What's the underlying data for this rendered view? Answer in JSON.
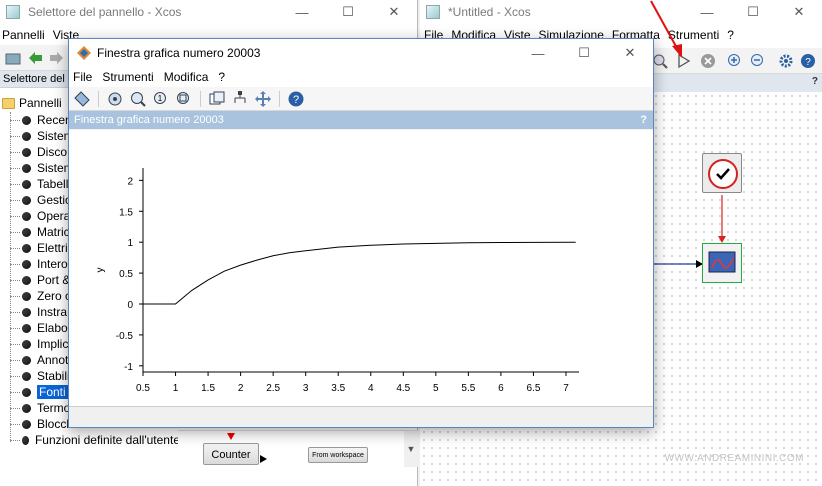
{
  "left_window": {
    "title": "Selettore del pannello - Xcos",
    "menu": [
      "Pannelli",
      "Viste"
    ],
    "panel_header": "Selettore del p",
    "tree_root": "Pannelli",
    "tree_items": [
      "Recen",
      "Sistem",
      "Disco",
      "Sistem",
      "Tabell",
      "Gestio",
      "Opera",
      "Matric",
      "Elettri",
      "Intero",
      "Port &",
      "Zero c",
      "Instra",
      "Elabor",
      "Implici",
      "Annot",
      "Stabili",
      "Fonti",
      "Termo",
      "Blocch",
      "Funzioni definite dall'utente"
    ],
    "selected_item": "Fonti",
    "blocks": {
      "counter": "Counter",
      "from_workspace": "From workspace"
    }
  },
  "right_window": {
    "title": "*Untitled - Xcos",
    "menu": [
      "File",
      "Modifica",
      "Viste",
      "Simulazione",
      "Formatta",
      "Strumenti",
      "?"
    ],
    "watermark": "WWW.ANDREAMININI.COM"
  },
  "graphic_window": {
    "title": "Finestra grafica numero 20003",
    "menu": [
      "File",
      "Strumenti",
      "Modifica",
      "?"
    ],
    "figure_band": "Finestra grafica numero 20003",
    "help_glyph": "?"
  },
  "chart_data": {
    "type": "line",
    "title": "",
    "xlabel": "",
    "ylabel": "y",
    "xlim": [
      0.5,
      7.2
    ],
    "ylim": [
      -1.1,
      2.2
    ],
    "x_ticks": [
      0.5,
      1,
      1.5,
      2,
      2.5,
      3,
      3.5,
      4,
      4.5,
      5,
      5.5,
      6,
      6.5,
      7
    ],
    "y_ticks": [
      -1,
      -0.5,
      0,
      0.5,
      1,
      1.5,
      2
    ],
    "series": [
      {
        "x": [
          0.5,
          1.0,
          1.25,
          1.5,
          1.75,
          2.0,
          2.25,
          2.5,
          2.75,
          3.0,
          3.5,
          4.0,
          4.5,
          5.0,
          5.5,
          6.0,
          6.5,
          7.15
        ],
        "y": [
          0,
          0,
          0.22,
          0.39,
          0.53,
          0.63,
          0.71,
          0.78,
          0.83,
          0.86,
          0.92,
          0.95,
          0.97,
          0.98,
          0.99,
          0.995,
          0.997,
          1.0
        ]
      }
    ]
  }
}
